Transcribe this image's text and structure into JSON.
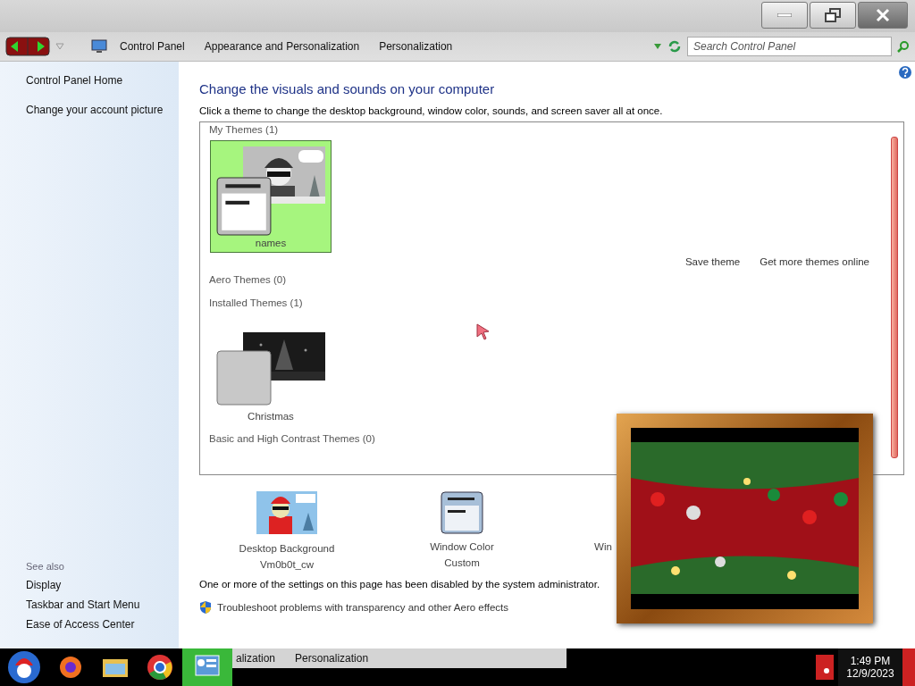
{
  "address_bar": {
    "breadcrumbs": [
      "Control Panel",
      "Appearance and Personalization",
      "Personalization"
    ]
  },
  "search": {
    "placeholder": "Search Control Panel"
  },
  "sidebar": {
    "items": [
      "Control Panel Home",
      "Change your account picture"
    ],
    "see_also": {
      "title": "See also",
      "items": [
        "Display",
        "Taskbar and Start Menu",
        "Ease of Access Center"
      ]
    }
  },
  "main": {
    "heading": "Change the visuals and sounds on your computer",
    "subtitle": "Click a theme to change the desktop background, window color, sounds, and screen saver all at once.",
    "theme_groups": [
      {
        "title": "My Themes (1)",
        "themes": [
          {
            "name": "names",
            "selected": true,
            "kind": "comic"
          }
        ],
        "links": [
          "Save theme",
          "Get more themes online"
        ]
      },
      {
        "title": "Aero Themes (0)"
      },
      {
        "title": "Installed Themes (1)",
        "themes": [
          {
            "name": "Christmas",
            "selected": false,
            "kind": "dark"
          }
        ]
      },
      {
        "title": "Basic and High Contrast Themes (0)"
      }
    ],
    "settings": [
      {
        "kind": "background",
        "label": "Desktop Background",
        "value": "Vm0b0t_cw"
      },
      {
        "kind": "color",
        "label": "Window Color",
        "value": "Custom"
      },
      {
        "kind": "sounds",
        "label": "Win"
      }
    ],
    "notice": "One or more of the settings on this page has been disabled by the system administrator.",
    "troubleshoot": "Troubleshoot problems with transparency and other Aero effects"
  },
  "taskbar": {
    "buttons": [
      "alization",
      "Personalization"
    ],
    "time": "1:49 PM",
    "date": "12/9/2023"
  }
}
